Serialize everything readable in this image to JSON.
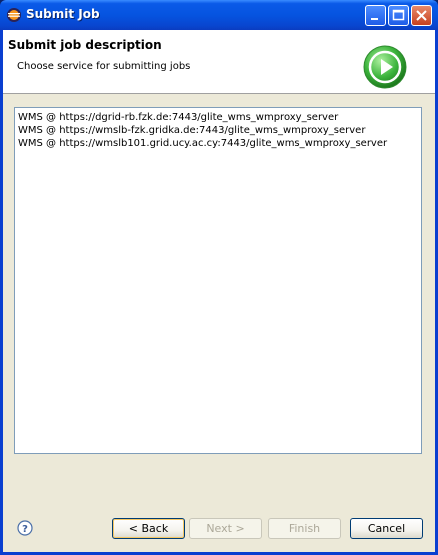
{
  "window": {
    "title": "Submit Job"
  },
  "header": {
    "title": "Submit job description",
    "subtitle": "Choose service for submitting jobs"
  },
  "services": [
    "WMS @ https://dgrid-rb.fzk.de:7443/glite_wms_wmproxy_server",
    "WMS @ https://wmslb-fzk.gridka.de:7443/glite_wms_wmproxy_server",
    "WMS @ https://wmslb101.grid.ucy.ac.cy:7443/glite_wms_wmproxy_server"
  ],
  "buttons": {
    "back": "< Back",
    "next": "Next >",
    "finish": "Finish",
    "cancel": "Cancel"
  },
  "colors": {
    "titlebar": "#0654e0",
    "dialog_bg": "#ece9d8",
    "accent_green": "#3cb43c"
  },
  "icons": [
    "eclipse-logo-icon",
    "minimize-icon",
    "maximize-icon",
    "close-icon",
    "play-arrow-icon",
    "help-icon"
  ]
}
